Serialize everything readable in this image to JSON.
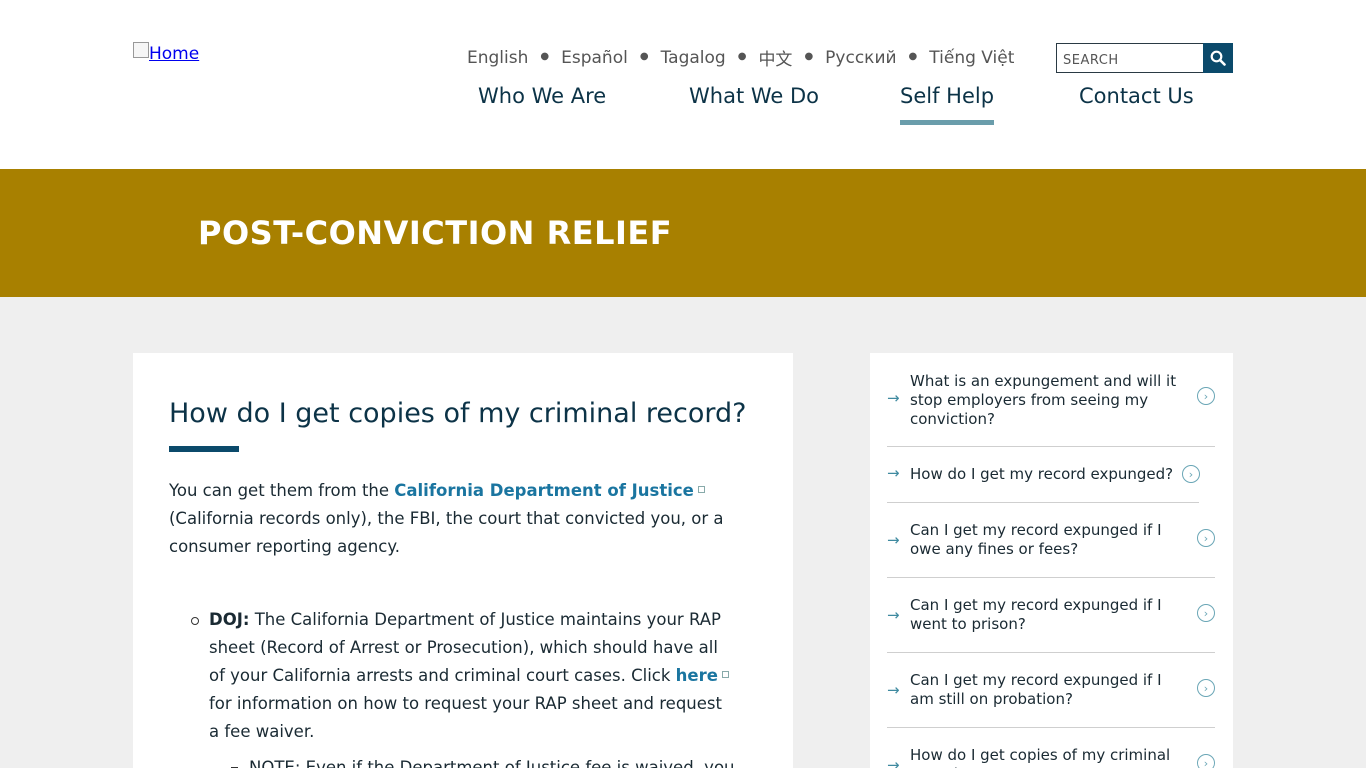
{
  "header": {
    "logo_alt": "Home",
    "languages": [
      "English",
      "Español",
      "Tagalog",
      "中文",
      "Русский",
      "Tiếng Việt"
    ],
    "search_placeholder": "SEARCH",
    "nav": [
      {
        "label": "Who We Are",
        "active": false
      },
      {
        "label": "What We Do",
        "active": false
      },
      {
        "label": "Self Help",
        "active": true
      },
      {
        "label": "Contact Us",
        "active": false
      }
    ]
  },
  "banner": {
    "title": "POST-CONVICTION RELIEF"
  },
  "article": {
    "heading": "How do I get copies of my criminal record?",
    "intro_prefix": "You can get them from the ",
    "intro_link": "California Department of Justice",
    "intro_suffix": " (California records only), the FBI, the court that convicted you, or a consumer reporting agency.",
    "doj_label": "DOJ:",
    "doj_text": " The California Department of Justice maintains your RAP sheet (Record of Arrest or Prosecution), which should have all of your California arrests and criminal court cases. Click ",
    "doj_link": "here",
    "doj_text_after": " for information on how to request your RAP sheet and request a fee waiver.",
    "note_text": "NOTE: Even if the Department of Justice fee is waived, you"
  },
  "sidebar": {
    "items": [
      "What is an expungement and will it stop employers from seeing my conviction?",
      "How do I get my record expunged?",
      "Can I get my record expunged if I owe any fines or fees?",
      "Can I get my record expunged if I went to prison?",
      "Can I get my record expunged if I am still on probation?",
      "How do I get copies of my criminal record?"
    ]
  },
  "colors": {
    "banner": "#a88000",
    "nav_text": "#0c3347",
    "link": "#1a75a0",
    "active_underline": "#6a9dab",
    "search_button": "#0b4a6b"
  }
}
